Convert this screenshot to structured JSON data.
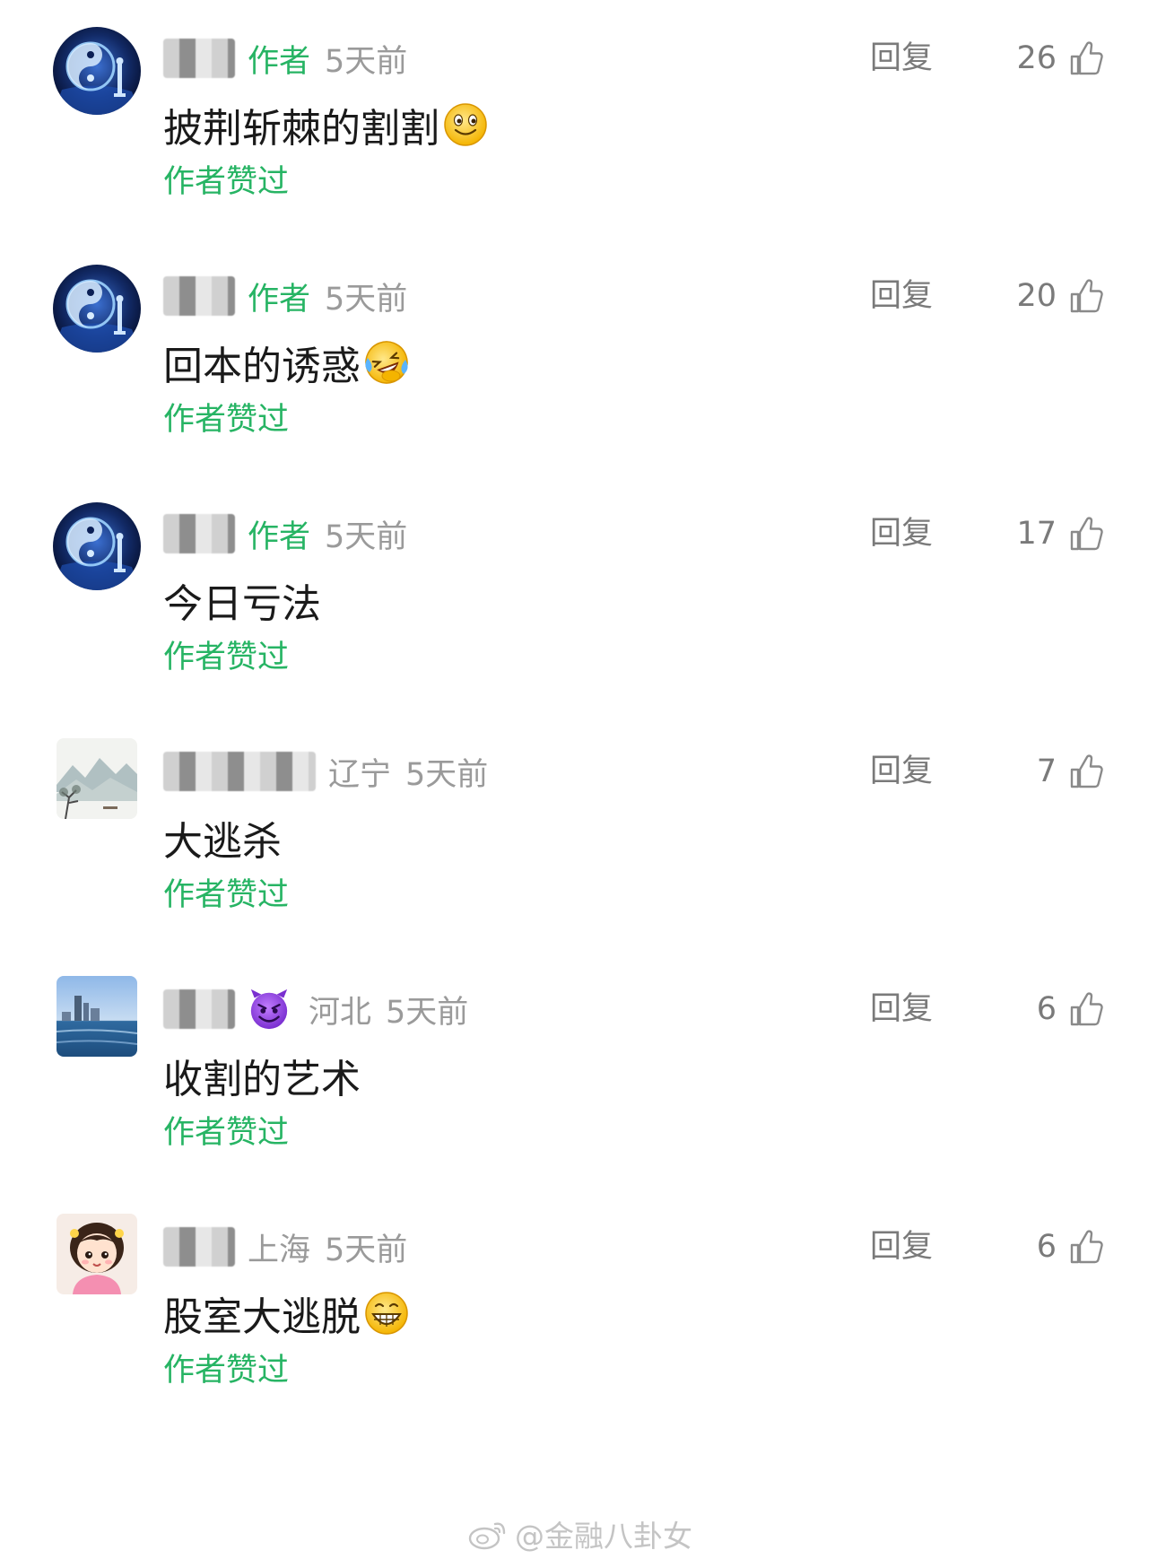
{
  "comments": [
    {
      "author_tag": "作者",
      "location": "",
      "time": "5天前",
      "text": "披荆斩棘的割割",
      "text_emoji": "smile-emoji",
      "reply_label": "回复",
      "likes": "26",
      "liked_label": "作者赞过",
      "avatar": "yin-yang-avatar"
    },
    {
      "author_tag": "作者",
      "location": "",
      "time": "5天前",
      "text": "回本的诱惑",
      "text_emoji": "laughing-tears-emoji",
      "reply_label": "回复",
      "likes": "20",
      "liked_label": "作者赞过",
      "avatar": "yin-yang-avatar"
    },
    {
      "author_tag": "作者",
      "location": "",
      "time": "5天前",
      "text": "今日亏法",
      "text_emoji": "",
      "reply_label": "回复",
      "likes": "17",
      "liked_label": "作者赞过",
      "avatar": "yin-yang-avatar"
    },
    {
      "author_tag": "",
      "location": "辽宁",
      "time": "5天前",
      "text": "大逃杀",
      "text_emoji": "",
      "reply_label": "回复",
      "likes": "7",
      "liked_label": "作者赞过",
      "avatar": "landscape-painting-avatar"
    },
    {
      "author_tag": "",
      "location": "河北",
      "time": "5天前",
      "text": "收割的艺术",
      "text_emoji": "",
      "name_emoji": "smiling-devil-emoji",
      "reply_label": "回复",
      "likes": "6",
      "liked_label": "作者赞过",
      "avatar": "seaside-city-avatar"
    },
    {
      "author_tag": "",
      "location": "上海",
      "time": "5天前",
      "text": "股室大逃脱",
      "text_emoji": "grinning-emoji",
      "reply_label": "回复",
      "likes": "6",
      "liked_label": "作者赞过",
      "avatar": "cartoon-girl-avatar"
    }
  ],
  "watermark": {
    "text": "@金融八卦女",
    "icon": "weibo-icon"
  },
  "colors": {
    "green": "#27b464",
    "gray": "#9a9a9a",
    "text": "#1a1a1a"
  }
}
